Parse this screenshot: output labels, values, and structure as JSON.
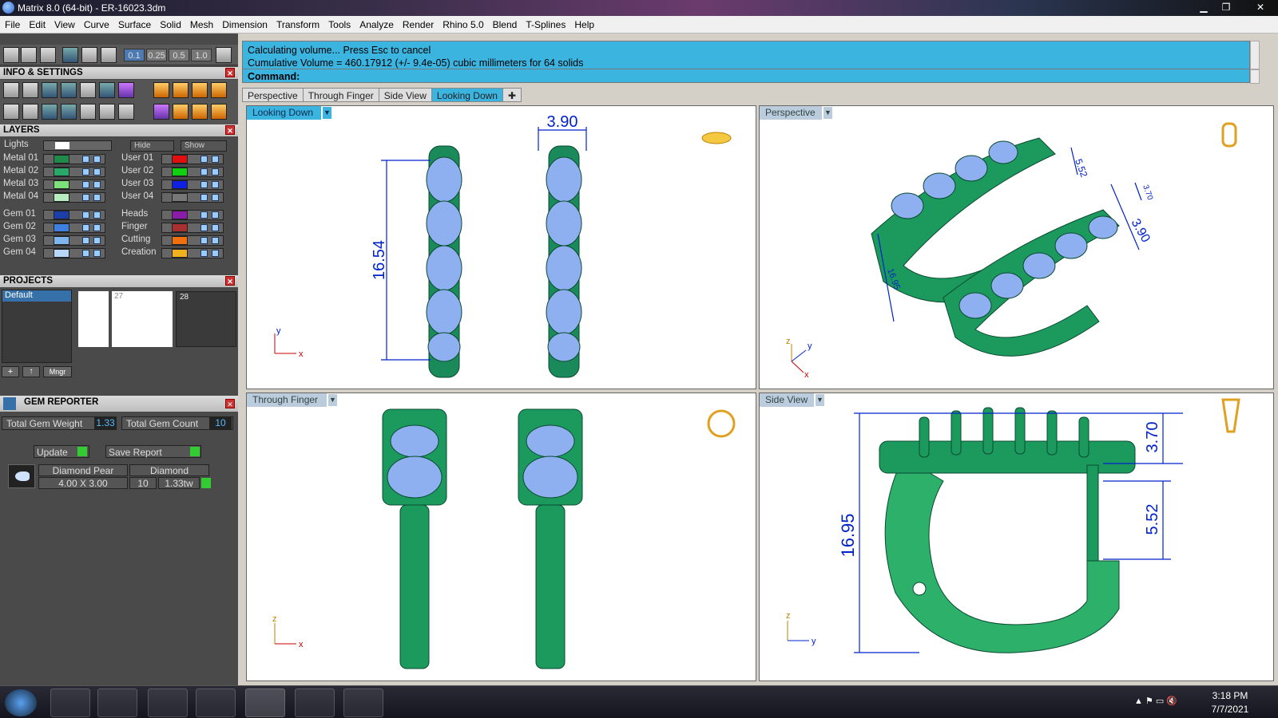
{
  "window": {
    "title": "Matrix 8.0 (64-bit) - ER-16023.3dm"
  },
  "menu": [
    "File",
    "Edit",
    "View",
    "Curve",
    "Surface",
    "Solid",
    "Mesh",
    "Dimension",
    "Transform",
    "Tools",
    "Analyze",
    "Render",
    "Rhino 5.0",
    "Blend",
    "T-Splines",
    "Help"
  ],
  "snap_values": [
    "0.1",
    "0.25",
    "0.5",
    "1.0"
  ],
  "panels": {
    "info": "INFO & SETTINGS",
    "layers": "LAYERS",
    "projects": "PROJECTS",
    "gem_reporter": "GEM REPORTER"
  },
  "layers": {
    "lights": "Lights",
    "hide": "Hide",
    "show": "Show",
    "left": [
      {
        "name": "Metal 01",
        "color": "#1f8a4a"
      },
      {
        "name": "Metal 02",
        "color": "#2aa86a"
      },
      {
        "name": "Metal 03",
        "color": "#7ee07a"
      },
      {
        "name": "Metal 04",
        "color": "#b6ecc0"
      },
      {
        "name": "Gem 01",
        "color": "#1c3ea8"
      },
      {
        "name": "Gem 02",
        "color": "#3f7fe0"
      },
      {
        "name": "Gem 03",
        "color": "#7fb4ef"
      },
      {
        "name": "Gem 04",
        "color": "#b8d6f7"
      }
    ],
    "right": [
      {
        "name": "User 01",
        "color": "#e01010"
      },
      {
        "name": "User 02",
        "color": "#10d010"
      },
      {
        "name": "User 03",
        "color": "#1020e0"
      },
      {
        "name": "User 04",
        "color": "#777777"
      },
      {
        "name": "Heads",
        "color": "#8a1aa8"
      },
      {
        "name": "Finger",
        "color": "#a83030"
      },
      {
        "name": "Cutting",
        "color": "#f07010"
      },
      {
        "name": "Creation",
        "color": "#f0b020"
      }
    ]
  },
  "projects": {
    "default": "Default",
    "thumb2": "27",
    "thumb3": "28",
    "mngr": "Mngr"
  },
  "gem": {
    "weight_label": "Total Gem Weight",
    "weight": "1.33",
    "count_label": "Total Gem Count",
    "count": "10",
    "update": "Update",
    "save": "Save Report",
    "row": {
      "shape": "Diamond Pear",
      "type": "Diamond",
      "size": "4.00 X 3.00",
      "qty": "10",
      "tw": "1.33tw"
    }
  },
  "command": {
    "line1": "Calculating volume... Press Esc to cancel",
    "line2": "Cumulative Volume = 460.17912 (+/- 9.4e-05) cubic millimeters for 64 solids",
    "prompt": "Command:"
  },
  "tabs": [
    "Perspective",
    "Through Finger",
    "Side View",
    "Looking Down"
  ],
  "active_tab": "Looking Down",
  "viewports": {
    "top_left": {
      "label": "Looking Down",
      "dim_w": "3.90",
      "dim_h": "16.54",
      "axis_a": "y",
      "axis_b": "x"
    },
    "top_right": {
      "label": "Perspective",
      "dims": [
        "5.52",
        "3.70",
        "3.90",
        "16.95"
      ],
      "axis_a": "z",
      "axis_b": "y",
      "axis_c": "x"
    },
    "bottom_left": {
      "label": "Through Finger",
      "axis_a": "z",
      "axis_b": "x"
    },
    "bottom_right": {
      "label": "Side View",
      "dims": [
        "3.70",
        "5.52",
        "16.95"
      ],
      "axis_a": "z",
      "axis_b": "y"
    }
  },
  "taskbar": {
    "time": "3:18 PM",
    "date": "7/7/2021"
  }
}
